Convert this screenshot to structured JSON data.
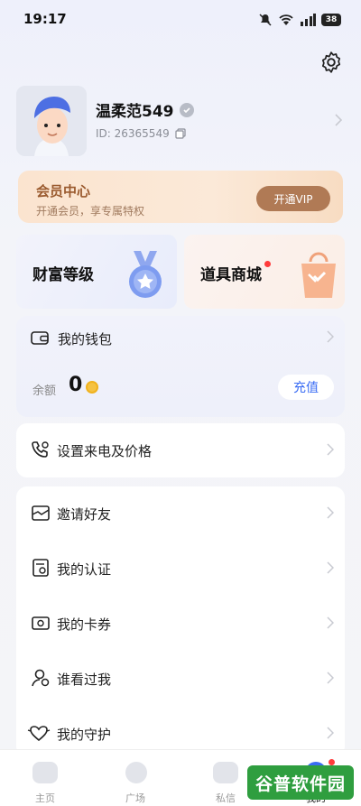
{
  "status_bar": {
    "time": "19:17",
    "battery": "38"
  },
  "profile": {
    "username": "温柔范549",
    "user_id": "ID: 26365549"
  },
  "vip": {
    "title": "会员中心",
    "subtitle": "开通会员，享专属特权",
    "button": "开通VIP"
  },
  "tiles": {
    "wealth": "财富等级",
    "shop": "道具商城"
  },
  "wallet": {
    "title": "我的钱包",
    "balance_label": "余额",
    "balance_value": "0",
    "recharge": "充值"
  },
  "menu": {
    "call_price": "设置来电及价格",
    "items": [
      {
        "label": "邀请好友",
        "icon": "invite-icon"
      },
      {
        "label": "我的认证",
        "icon": "certify-icon"
      },
      {
        "label": "我的卡券",
        "icon": "coupon-icon"
      },
      {
        "label": "谁看过我",
        "icon": "visitor-icon"
      },
      {
        "label": "我的守护",
        "icon": "guard-icon"
      }
    ]
  },
  "tabbar": [
    {
      "label": "主页"
    },
    {
      "label": "广场"
    },
    {
      "label": "私信"
    },
    {
      "label": "我的"
    }
  ],
  "watermark": "谷普软件园",
  "colors": {
    "accent": "#3a6cf4",
    "vip_brown": "#b07a55",
    "notify_red": "#ff3b3b"
  }
}
